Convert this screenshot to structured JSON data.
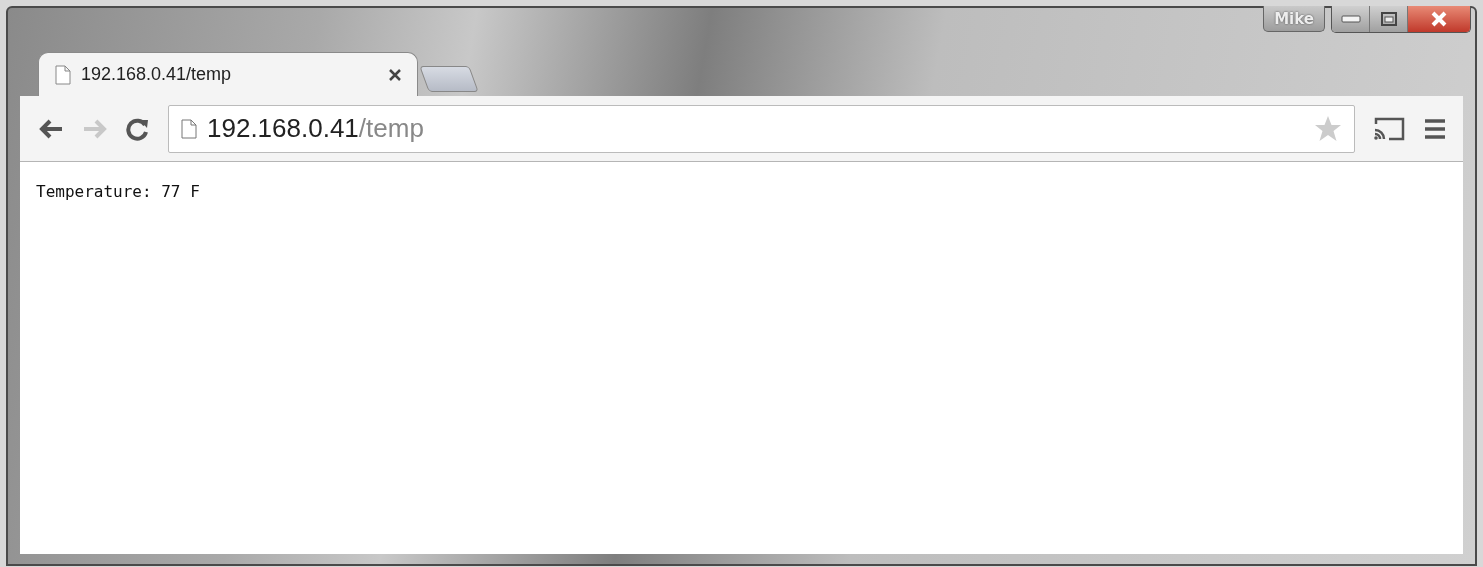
{
  "window": {
    "user": "Mike"
  },
  "tabs": [
    {
      "title": "192.168.0.41/temp",
      "selected": true
    }
  ],
  "toolbar": {
    "back_disabled": false,
    "forward_disabled": true,
    "address": {
      "host": "192.168.0.41",
      "path": "/temp"
    }
  },
  "page": {
    "text": "Temperature: 77 F"
  }
}
